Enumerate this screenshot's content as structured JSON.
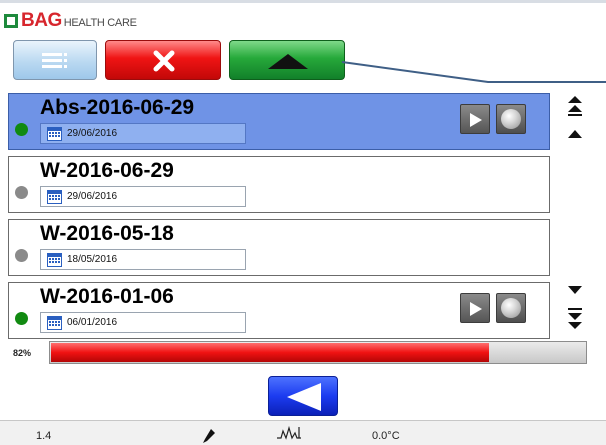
{
  "header": {
    "logo_brand": "BAG",
    "logo_sub": "HEALTH CARE"
  },
  "toolbar": {
    "list_icon": "list-icon",
    "cancel_icon": "close-icon",
    "up_icon": "triangle-up-icon"
  },
  "rows": [
    {
      "title": "Abs-2016-06-29",
      "date": "29/06/2016",
      "status": "green",
      "selected": true,
      "has_actions": true
    },
    {
      "title": "W-2016-06-29",
      "date": "29/06/2016",
      "status": "grey",
      "selected": false,
      "has_actions": false
    },
    {
      "title": "W-2016-05-18",
      "date": "18/05/2016",
      "status": "grey",
      "selected": false,
      "has_actions": false
    },
    {
      "title": "W-2016-01-06",
      "date": "06/01/2016",
      "status": "green",
      "selected": false,
      "has_actions": true
    }
  ],
  "progress": {
    "label": "82%",
    "value": 0.82
  },
  "statusbar": {
    "left_value": "1.4",
    "temperature": "0.0°C",
    "icons": [
      "pipette-icon",
      "waveform-icon"
    ]
  },
  "colors": {
    "status_green": "#118a11",
    "status_grey": "#8a8a8a",
    "selected_row": "#6f93e6",
    "progress_red": "#e51515"
  }
}
